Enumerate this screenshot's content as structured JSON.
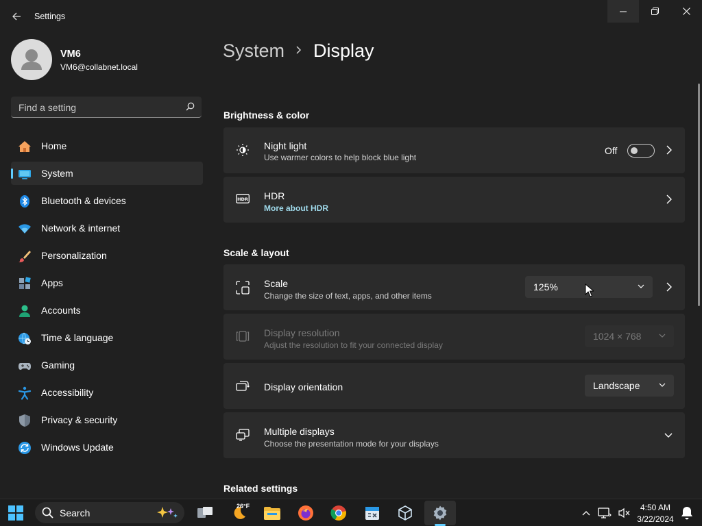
{
  "window": {
    "title": "Settings"
  },
  "profile": {
    "name": "VM6",
    "email": "VM6@collabnet.local"
  },
  "search": {
    "placeholder": "Find a setting"
  },
  "nav": {
    "items": [
      {
        "label": "Home",
        "icon": "home-icon",
        "active": false
      },
      {
        "label": "System",
        "icon": "system-icon",
        "active": true
      },
      {
        "label": "Bluetooth & devices",
        "icon": "bluetooth-icon",
        "active": false
      },
      {
        "label": "Network & internet",
        "icon": "wifi-icon",
        "active": false
      },
      {
        "label": "Personalization",
        "icon": "brush-icon",
        "active": false
      },
      {
        "label": "Apps",
        "icon": "apps-icon",
        "active": false
      },
      {
        "label": "Accounts",
        "icon": "accounts-icon",
        "active": false
      },
      {
        "label": "Time & language",
        "icon": "globe-clock-icon",
        "active": false
      },
      {
        "label": "Gaming",
        "icon": "gamepad-icon",
        "active": false
      },
      {
        "label": "Accessibility",
        "icon": "accessibility-icon",
        "active": false
      },
      {
        "label": "Privacy & security",
        "icon": "shield-icon",
        "active": false
      },
      {
        "label": "Windows Update",
        "icon": "update-icon",
        "active": false
      }
    ]
  },
  "breadcrumb": {
    "parent": "System",
    "current": "Display"
  },
  "sections": {
    "brightness": "Brightness & color",
    "scale_layout": "Scale & layout",
    "related": "Related settings"
  },
  "cards": {
    "night_light": {
      "title": "Night light",
      "subtitle": "Use warmer colors to help block blue light",
      "state": "Off",
      "toggle_on": false
    },
    "hdr": {
      "title": "HDR",
      "link": "More about HDR"
    },
    "scale": {
      "title": "Scale",
      "subtitle": "Change the size of text, apps, and other items",
      "value": "125%"
    },
    "resolution": {
      "title": "Display resolution",
      "subtitle": "Adjust the resolution to fit your connected display",
      "value": "1024 × 768",
      "disabled": true
    },
    "orientation": {
      "title": "Display orientation",
      "value": "Landscape"
    },
    "multiple": {
      "title": "Multiple displays",
      "subtitle": "Choose the presentation mode for your displays"
    }
  },
  "taskbar": {
    "search_label": "Search",
    "weather_temp": "26°F",
    "time": "4:50 AM",
    "date": "3/22/2024"
  },
  "colors": {
    "accent": "#60cdff",
    "background": "#202020",
    "card": "#2b2b2b",
    "link": "#9fd9ea"
  }
}
